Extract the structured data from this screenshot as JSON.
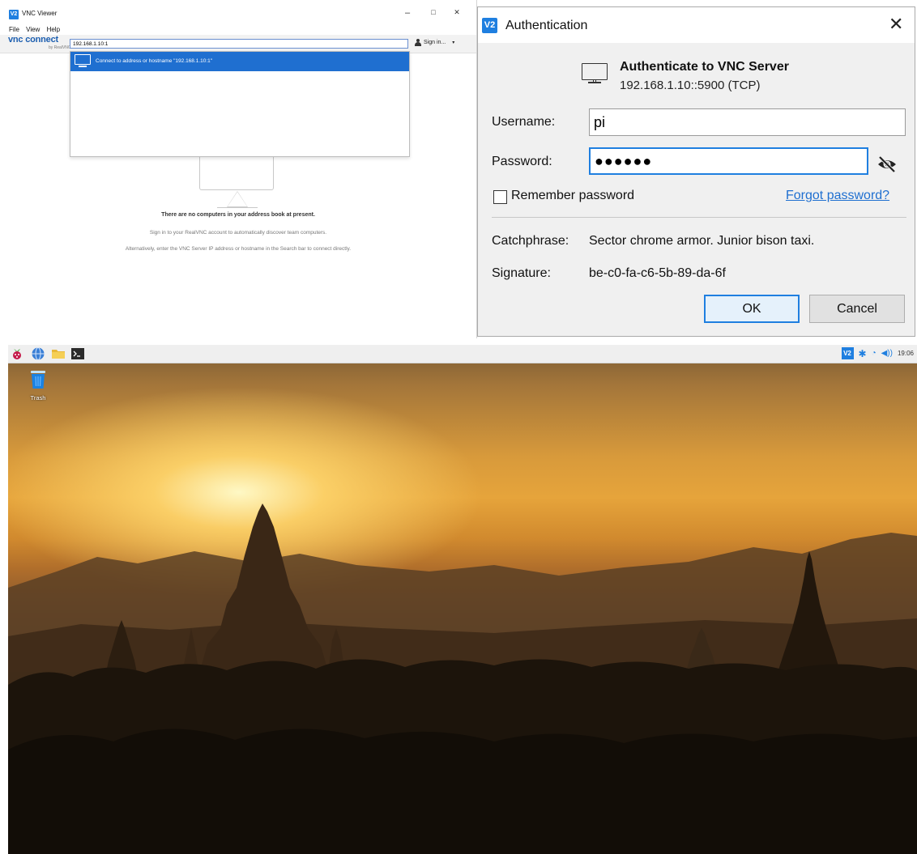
{
  "vnc_viewer": {
    "logo": "V2",
    "title": "VNC Viewer",
    "window_controls": {
      "minimize": "–",
      "maximize": "□",
      "close": "✕"
    },
    "menu": [
      "File",
      "View",
      "Help"
    ],
    "brand": "vnc connect",
    "brand_sub": "by RealVNC",
    "search_value": "192.168.1.10:1",
    "sign_in_label": "Sign in...",
    "sign_in_caret": "▾",
    "dropdown_item": "Connect to address or hostname \"192.168.1.10:1\"",
    "empty_heading": "There are no computers in your address book at present.",
    "empty_line1": "Sign in to your RealVNC account to automatically discover team computers.",
    "empty_line2": "Alternatively, enter the VNC Server IP address or hostname in the Search bar to connect directly."
  },
  "auth_dialog": {
    "logo": "V2",
    "title": "Authentication",
    "close": "✕",
    "server_title": "Authenticate to VNC Server",
    "server_address": "192.168.1.10::5900 (TCP)",
    "username_label": "Username:",
    "username_value": "pi",
    "password_label": "Password:",
    "password_value": "●●●●●●",
    "remember_label": "Remember password",
    "remember_checked": false,
    "forgot_label": "Forgot password?",
    "catchphrase_label": "Catchphrase:",
    "catchphrase_value": "Sector chrome armor. Junior bison taxi.",
    "signature_label": "Signature:",
    "signature_value": "be-c0-fa-c6-5b-89-da-6f",
    "ok_label": "OK",
    "cancel_label": "Cancel",
    "accent_color": "#1f7fe0"
  },
  "desktop": {
    "taskbar_icons": [
      "raspberry-icon",
      "globe-icon",
      "folder-icon",
      "terminal-icon"
    ],
    "tray": {
      "vnc": "V2",
      "bluetooth": "✱",
      "wifi": "◔",
      "volume": "◀))",
      "clock": "19:06"
    },
    "trash_label": "Trash"
  }
}
